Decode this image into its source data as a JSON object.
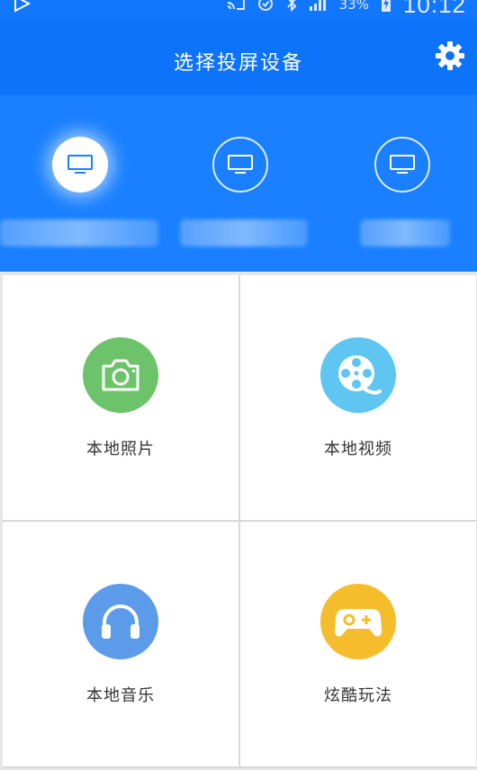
{
  "status_bar": {
    "battery_percent": "33%",
    "time": "10:12"
  },
  "header": {
    "title": "选择投屏设备",
    "settings_icon": "gear-icon"
  },
  "devices": [
    {
      "icon": "monitor-icon",
      "name": "",
      "selected": true
    },
    {
      "icon": "monitor-icon",
      "name": "",
      "selected": false
    },
    {
      "icon": "monitor-icon",
      "name": "",
      "selected": false
    }
  ],
  "menu": [
    {
      "label": "本地照片",
      "icon": "camera-icon",
      "color": "#6cc36a"
    },
    {
      "label": "本地视频",
      "icon": "film-reel-icon",
      "color": "#5ec6f0"
    },
    {
      "label": "本地音乐",
      "icon": "headphones-icon",
      "color": "#5c9bea"
    },
    {
      "label": "炫酷玩法",
      "icon": "gamepad-icon",
      "color": "#f5bd2c"
    }
  ],
  "colors": {
    "primary": "#0d73fb",
    "device_strip": "#1a80ff"
  }
}
